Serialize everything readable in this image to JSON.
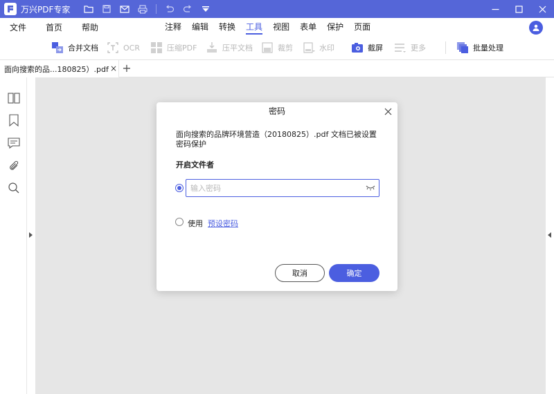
{
  "app": {
    "title": "万兴PDF专家",
    "accent_color": "#4b5ee0",
    "titlebar_color": "#5566d8"
  },
  "titlebar": {
    "quick_icons": [
      "folder-icon",
      "save-icon",
      "mail-icon",
      "print-icon",
      "undo-icon",
      "redo-icon",
      "dropdown-arrow-icon"
    ],
    "window_controls": [
      "minimize-icon",
      "maximize-icon",
      "close-icon"
    ]
  },
  "menu": {
    "left": [
      "文件",
      "首页",
      "帮助"
    ],
    "center": [
      "注释",
      "编辑",
      "转换",
      "工具",
      "视图",
      "表单",
      "保护",
      "页面"
    ],
    "active": "工具"
  },
  "toolbar": {
    "merge": "合并文档",
    "ocr": "OCR",
    "compress": "压缩PDF",
    "flatten": "压平文档",
    "crop": "裁剪",
    "watermark": "水印",
    "screenshot": "截屏",
    "more": "更多",
    "batch": "批量处理"
  },
  "tabs": {
    "doc_tab": "面向搜索的品...180825）.pdf",
    "close": "×",
    "add": "+"
  },
  "sidebar": {
    "icons": [
      "thumbnail-icon",
      "bookmark-icon",
      "comment-icon",
      "attachment-icon",
      "search-icon"
    ]
  },
  "dialog": {
    "title": "密码",
    "message": "面向搜索的品牌环境营造（20180825）.pdf 文档已被设置密码保护",
    "section": "开启文件者",
    "password_placeholder": "输入密码",
    "use_label": "使用",
    "preset_link": "预设密码",
    "cancel": "取消",
    "ok": "确定"
  }
}
